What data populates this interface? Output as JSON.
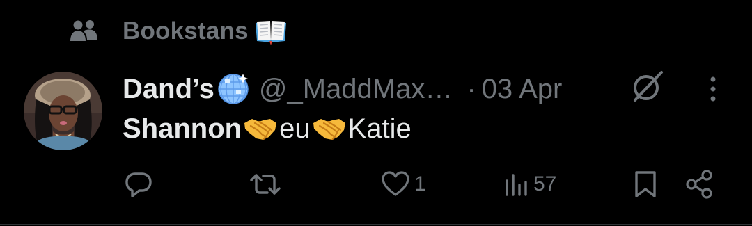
{
  "community": {
    "name": "Bookstans",
    "icon": "people-icon",
    "emoji": "open-book-emoji"
  },
  "post": {
    "author": {
      "display_name": "Dand’s",
      "name_emoji": "mirror-ball-emoji",
      "handle": "@_MaddMax…"
    },
    "separator": "·",
    "timestamp": "03 Apr",
    "text": {
      "part1": "Shannon",
      "part2": "eu",
      "part3": "Katie",
      "emoji": "handshake-emoji"
    },
    "actions": {
      "reply_count": "",
      "repost_count": "",
      "like_count": "1",
      "views_count": "57"
    }
  },
  "colors": {
    "background": "#000000",
    "primary_text": "#e7e9ea",
    "secondary_text": "#71767b"
  }
}
